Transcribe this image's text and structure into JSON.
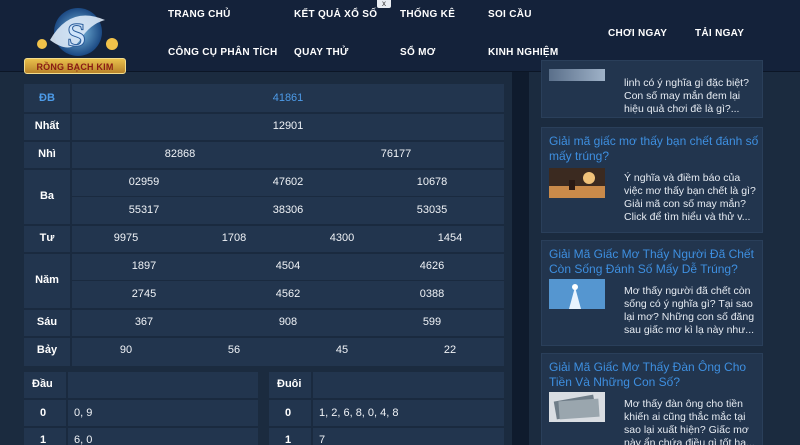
{
  "brand": {
    "logo_text": "RỒNG BẠCH KIM"
  },
  "nav": {
    "row1": [
      "TRANG CHỦ",
      "KẾT QUẢ XỔ SỐ",
      "THỐNG KÊ",
      "SOI CẦU"
    ],
    "row2": [
      "CÔNG CỤ PHÂN TÍCH",
      "QUAY THỬ",
      "SỔ MƠ",
      "KINH NGHIỆM"
    ],
    "play_now": "CHƠI NGAY",
    "download_now": "TẢI NGAY",
    "close": "x"
  },
  "results": {
    "db": {
      "label": "ĐB",
      "values": [
        "41861"
      ]
    },
    "nhat": {
      "label": "Nhất",
      "values": [
        "12901"
      ]
    },
    "nhi": {
      "label": "Nhì",
      "values": [
        "82868",
        "76177"
      ]
    },
    "ba": {
      "label": "Ba",
      "values": [
        "02959",
        "47602",
        "10678",
        "55317",
        "38306",
        "53035"
      ]
    },
    "tu": {
      "label": "Tư",
      "values": [
        "9975",
        "1708",
        "4300",
        "1454"
      ]
    },
    "nam": {
      "label": "Năm",
      "values": [
        "1897",
        "4504",
        "4626",
        "2745",
        "4562",
        "0388"
      ]
    },
    "sau": {
      "label": "Sáu",
      "values": [
        "367",
        "908",
        "599"
      ]
    },
    "bay": {
      "label": "Bảy",
      "values": [
        "90",
        "56",
        "45",
        "22"
      ]
    }
  },
  "dau": {
    "header": "Đầu",
    "rows": [
      {
        "num": "0",
        "val": "0, 9"
      },
      {
        "num": "1",
        "val": "6, 0"
      }
    ]
  },
  "duoi": {
    "header": "Đuôi",
    "rows": [
      {
        "num": "0",
        "val": "1, 2, 6, 8, 0, 4, 8"
      },
      {
        "num": "1",
        "val": "7"
      }
    ]
  },
  "sidebar": {
    "cards": [
      {
        "title": "",
        "text": [
          "linh có ý nghĩa gì đặc biệt?",
          "Con số may mắn đem lại",
          "hiệu quả chơi đề là gì?..."
        ]
      },
      {
        "title": "Giải mã giấc mơ thấy bạn chết đánh số mấy trúng?",
        "text": [
          "Ý nghĩa và điềm báo của",
          "việc mơ thấy bạn chết là gì?",
          "Giải mã con số may mắn?",
          "Click để tìm hiểu và thử v..."
        ]
      },
      {
        "title": "Giải Mã Giấc Mơ Thấy Người Đã Chết Còn Sống Đánh Số Mấy Dễ Trúng?",
        "text": [
          "Mơ thấy người đã chết còn",
          "sống có ý nghĩa gì? Tại sao",
          "lại mơ? Những con số đăng",
          "sau giấc mơ kì lạ này như..."
        ]
      },
      {
        "title": "Giải Mã Giấc Mơ Thấy Đàn Ông Cho Tiền Và Những Con Số?",
        "text": [
          "Mơ thấy đàn ông cho tiền",
          "khiến ai cũng thắc mắc tại",
          "sao lại xuất hiện? Giấc mơ",
          "này ẩn chứa điều gì tốt ha..."
        ]
      }
    ]
  }
}
